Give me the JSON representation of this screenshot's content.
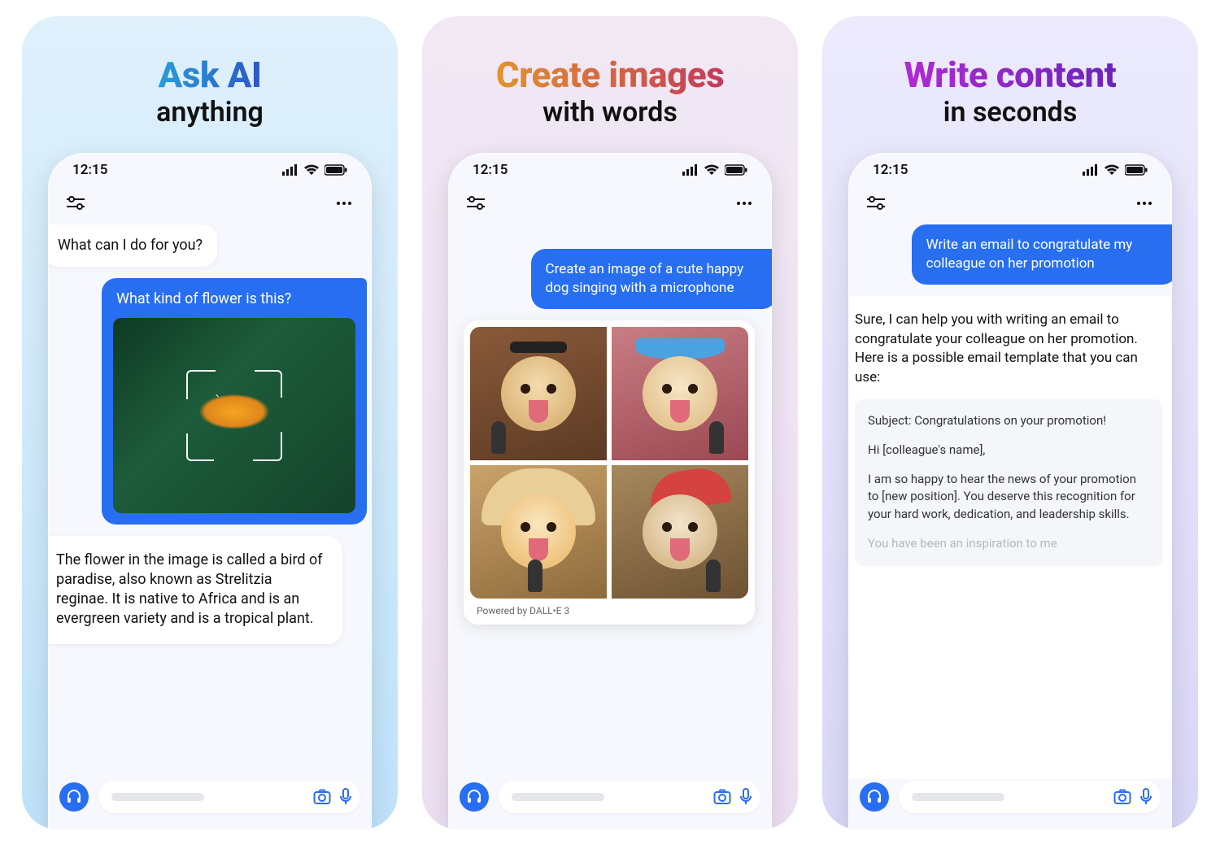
{
  "panels": [
    {
      "title": "Ask AI",
      "subtitle": "anything",
      "status_time": "12:15",
      "chat": {
        "assistant_greeting": "What can I do for you?",
        "user_question": "What kind of flower is this?",
        "assistant_answer": "The flower in the image is called a bird of paradise, also known as Strelitzia reginae. It is native to Africa and is an evergreen variety and is a tropical plant."
      }
    },
    {
      "title": "Create images",
      "subtitle": "with words",
      "status_time": "12:15",
      "chat": {
        "user_prompt": "Create an image of a cute happy dog singing with a microphone",
        "powered_by": "Powered by DALL•E 3"
      }
    },
    {
      "title": "Write content",
      "subtitle": "in seconds",
      "status_time": "12:15",
      "chat": {
        "user_prompt": "Write an email to congratulate my colleague on her promotion",
        "assistant_intro": "Sure, I can help you with writing an email to congratulate your colleague on her promotion. Here is a possible email template that you can use:",
        "email": {
          "subject": "Subject: Congratulations on your promotion!",
          "greeting": "Hi [colleague's name],",
          "body": "I am so happy to hear the news of your promotion to [new position]. You deserve this recognition for your hard work, dedication, and leadership skills.",
          "fade": "You have been an inspiration to me"
        }
      }
    }
  ]
}
